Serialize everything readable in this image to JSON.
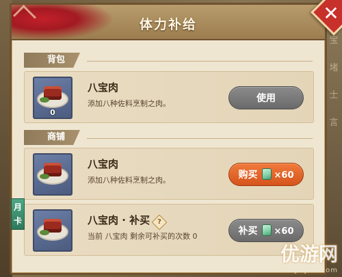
{
  "title": "体力补给",
  "sections": {
    "backpack": "背包",
    "shop": "商铺"
  },
  "backpack_item": {
    "name": "八宝肉",
    "desc": "添加八种佐料烹制之肉。",
    "count": "0",
    "button": "使用"
  },
  "shop_items": [
    {
      "name": "八宝肉",
      "desc": "添加八种佐料烹制之肉。",
      "button": "购买",
      "price": "×60"
    },
    {
      "tag": "月卡",
      "name": "八宝肉 · 补买",
      "desc": "当前  八宝肉  剩余可补买的次数 0",
      "button": "补买",
      "price": "×60"
    }
  ],
  "bg_side_text": "宝 堵 士 言",
  "watermark": {
    "text": "优游网",
    "url": "www.yoyou.com"
  },
  "colors": {
    "panel": "#efe6d2",
    "buy_button": "#e2622a",
    "use_button": "#777777",
    "month_tag": "#3a8e6c",
    "close_button": "#c8302c"
  },
  "icons": {
    "close": "close-icon",
    "currency": "jade-icon",
    "help": "question-icon"
  }
}
